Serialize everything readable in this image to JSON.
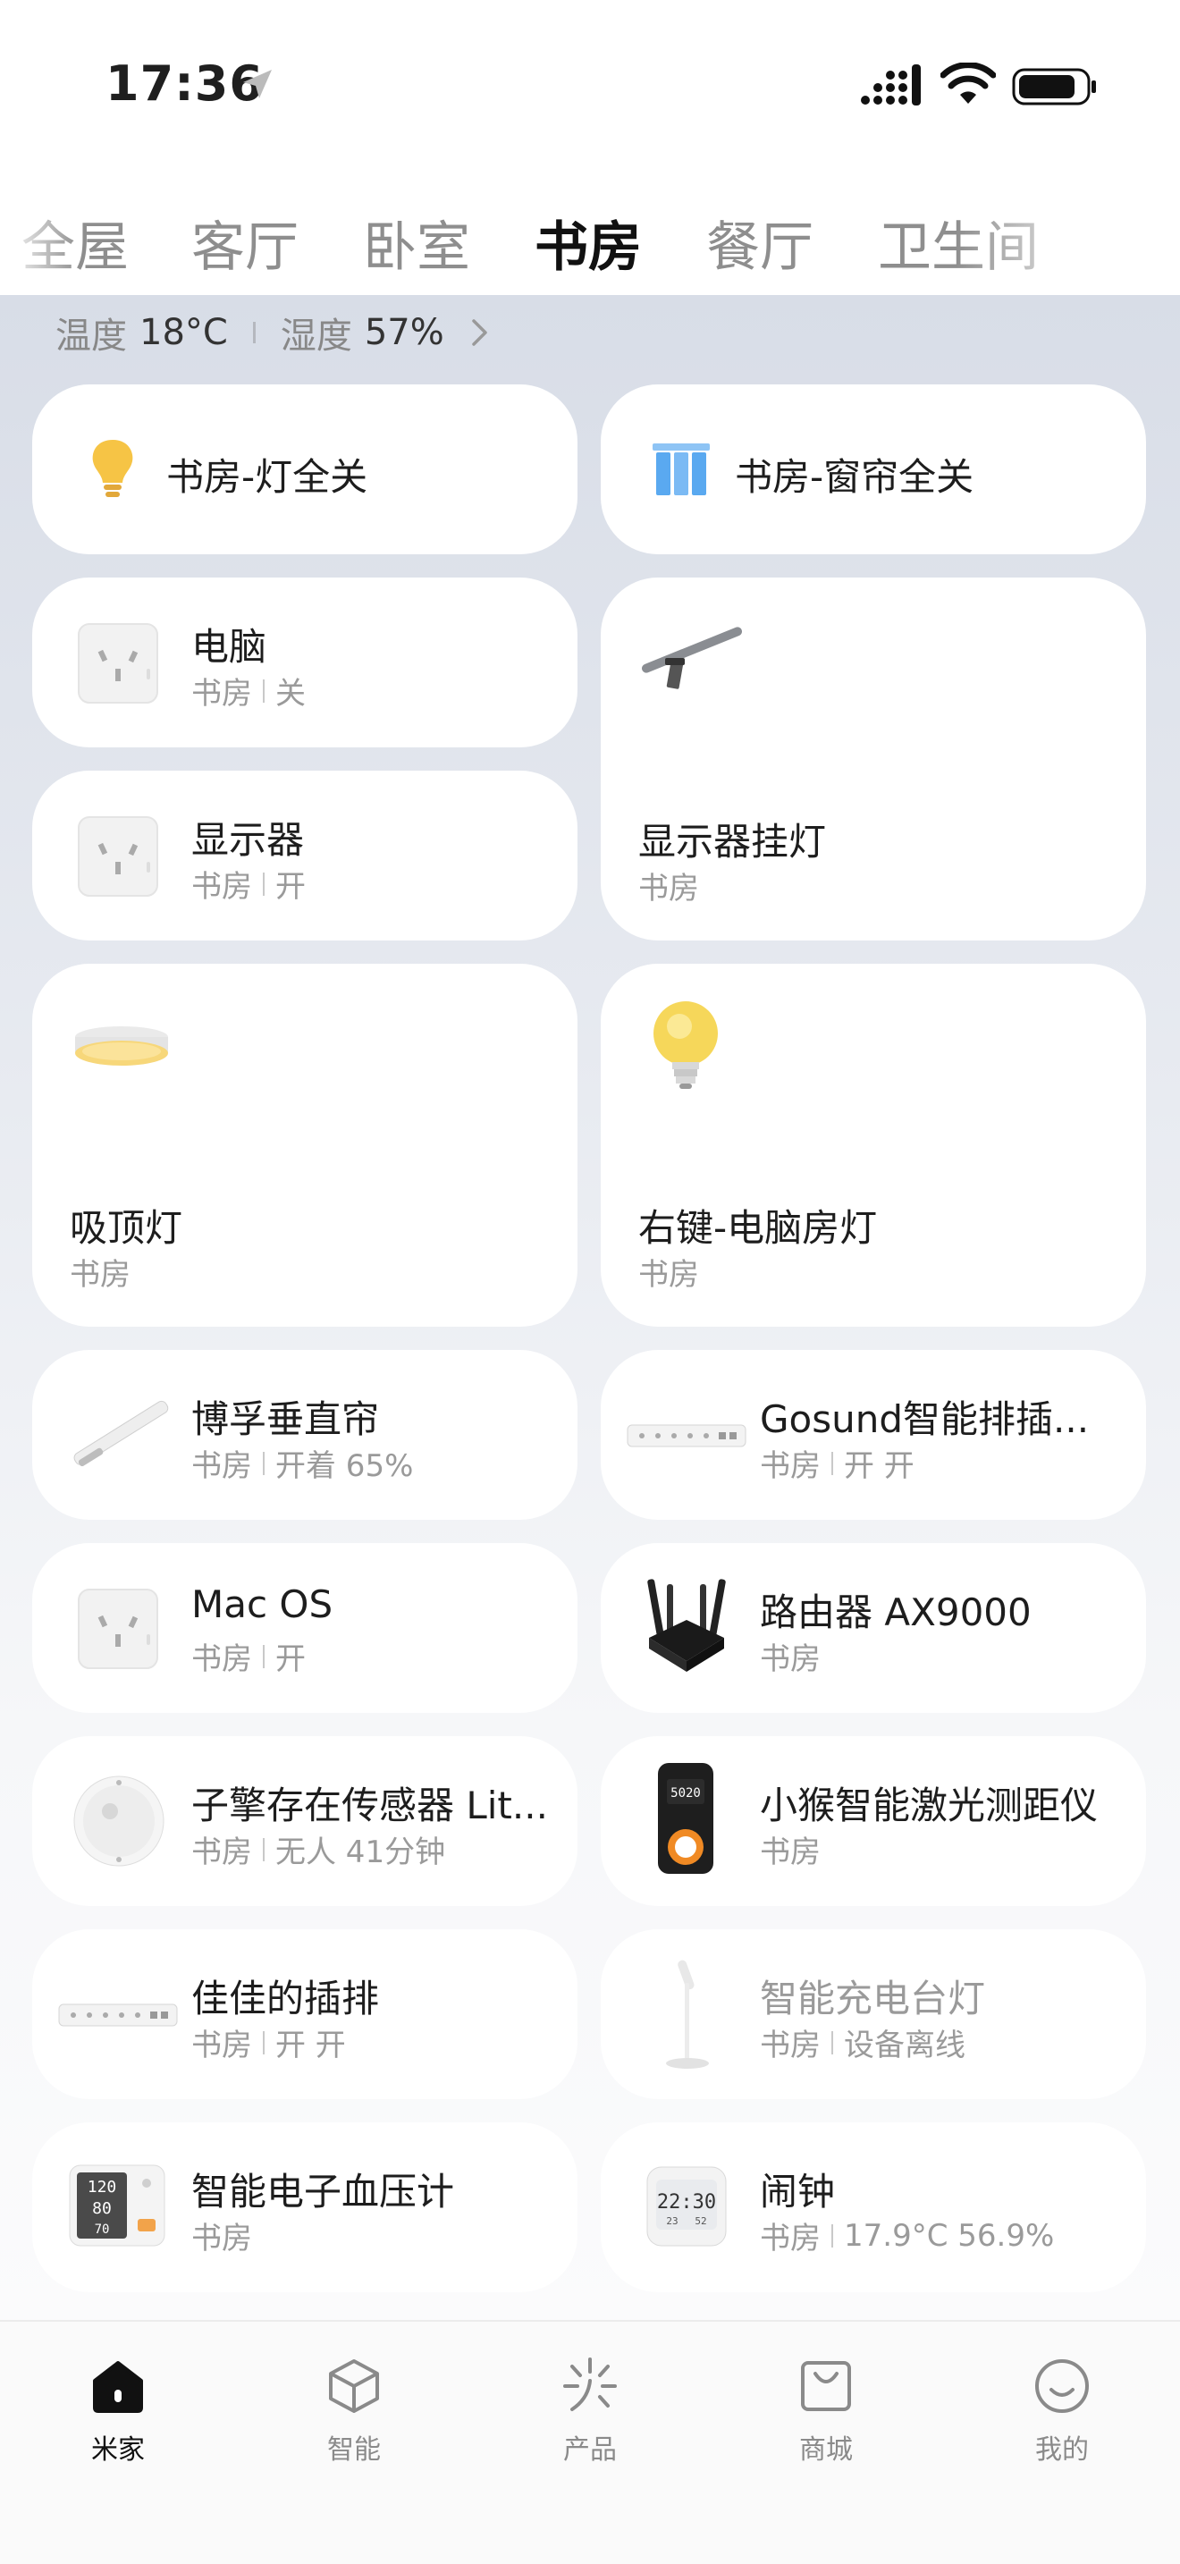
{
  "status_bar": {
    "time": "17:36"
  },
  "rooms": [
    "全屋",
    "客厅",
    "卧室",
    "书房",
    "餐厅",
    "卫生间"
  ],
  "active_room": "书房",
  "environment": {
    "temp_label": "温度",
    "temp_value": "18°C",
    "humidity_label": "湿度",
    "humidity_value": "57%"
  },
  "scenes": [
    {
      "name": "书房-灯全关",
      "icon": "bulb-icon"
    },
    {
      "name": "书房-窗帘全关",
      "icon": "curtain-icon"
    }
  ],
  "devices": [
    {
      "name": "电脑",
      "room": "书房",
      "state": "关",
      "icon": "socket-icon"
    },
    {
      "name": "显示器挂灯",
      "room": "书房",
      "icon": "monitor-light-bar-icon"
    },
    {
      "name": "显示器",
      "room": "书房",
      "state": "开",
      "icon": "socket-icon"
    },
    {
      "name": "吸顶灯",
      "room": "书房",
      "icon": "ceiling-light-icon"
    },
    {
      "name": "右键-电脑房灯",
      "room": "书房",
      "icon": "bulb-icon"
    },
    {
      "name": "博孚垂直帘",
      "room": "书房",
      "state": "开着 65%",
      "icon": "curtain-motor-icon"
    },
    {
      "name": "Gosund智能排插...",
      "room": "书房",
      "state": "开 开",
      "icon": "power-strip-icon"
    },
    {
      "name": "Mac OS",
      "room": "书房",
      "state": "开",
      "icon": "socket-icon"
    },
    {
      "name": "路由器 AX9000",
      "room": "书房",
      "icon": "router-icon"
    },
    {
      "name": "子擎存在传感器 Lit...",
      "room": "书房",
      "state": "无人 41分钟",
      "icon": "presence-sensor-icon"
    },
    {
      "name": "小猴智能激光测距仪",
      "room": "书房",
      "icon": "laser-rangefinder-icon"
    },
    {
      "name": "佳佳的插排",
      "room": "书房",
      "state": "开 开",
      "icon": "power-strip-icon"
    },
    {
      "name": "智能充电台灯",
      "room": "书房",
      "state": "设备离线",
      "icon": "desk-lamp-icon"
    },
    {
      "name": "智能电子血压计",
      "room": "书房",
      "icon": "blood-pressure-monitor-icon"
    },
    {
      "name": "闹钟",
      "room": "书房",
      "state": "17.9°C 56.9%",
      "icon": "alarm-clock-icon"
    }
  ],
  "device_screens": {
    "rangefinder": "5020",
    "bp_top": "120",
    "bp_mid": "80",
    "bp_bot": "70",
    "clock_time": "22:30",
    "clock_temp": "23",
    "clock_hum": "52"
  },
  "bottom_nav": [
    {
      "label": "米家",
      "icon": "home-icon"
    },
    {
      "label": "智能",
      "icon": "cube-icon"
    },
    {
      "label": "产品",
      "icon": "sparkle-icon"
    },
    {
      "label": "商城",
      "icon": "bag-icon"
    },
    {
      "label": "我的",
      "icon": "smile-icon"
    }
  ],
  "colors": {
    "accent_bulb": "#f6c445",
    "curtain_blue": "#5aa9f0",
    "active_text": "#111111",
    "muted_text": "#9a9a9a"
  }
}
